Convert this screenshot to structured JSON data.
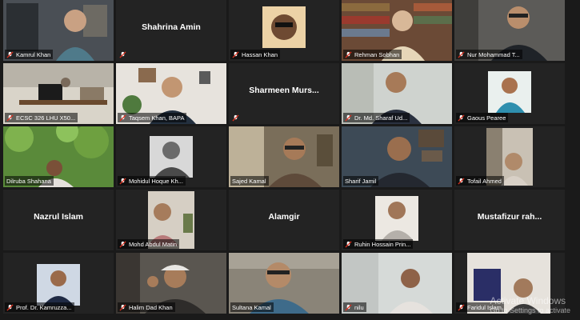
{
  "participants": [
    {
      "label": "Kamrul Khan",
      "center": "",
      "muted": true
    },
    {
      "label": "",
      "center": "Shahrina Amin",
      "muted": true
    },
    {
      "label": "Hassan Khan",
      "center": "",
      "muted": true
    },
    {
      "label": "Rehman Sobhan",
      "center": "",
      "muted": true
    },
    {
      "label": "Nur Mohammad T...",
      "center": "",
      "muted": true
    },
    {
      "label": "ECSC 326 LHU X50...",
      "center": "",
      "muted": true
    },
    {
      "label": "Taqsem Khan, BAPA",
      "center": "",
      "muted": true
    },
    {
      "label": "",
      "center": "Sharmeen  Murs...",
      "muted": true
    },
    {
      "label": "Dr. Md. Sharaf Ud...",
      "center": "",
      "muted": true
    },
    {
      "label": "Gaous Pearee",
      "center": "",
      "muted": true
    },
    {
      "label": "Dilruba Shahana",
      "center": "",
      "muted": false
    },
    {
      "label": "Mohidul Hoque Kh...",
      "center": "",
      "muted": true
    },
    {
      "label": "Sajed Kamal",
      "center": "",
      "muted": false
    },
    {
      "label": "Sharif Jamil",
      "center": "",
      "muted": false
    },
    {
      "label": "Tofail Ahmed",
      "center": "",
      "muted": true
    },
    {
      "label": "",
      "center": "Nazrul Islam",
      "muted": false
    },
    {
      "label": "Mohd Abdul Matin",
      "center": "",
      "muted": true
    },
    {
      "label": "",
      "center": "Alamgir",
      "muted": false
    },
    {
      "label": "Ruhin Hossain Prin...",
      "center": "",
      "muted": true
    },
    {
      "label": "",
      "center": "Mustafizur  rah...",
      "muted": false
    },
    {
      "label": "Prof. Dr. Kamruzza...",
      "center": "",
      "muted": true
    },
    {
      "label": "Halim Dad Khan",
      "center": "",
      "muted": true
    },
    {
      "label": "Sultana Kamal",
      "center": "",
      "muted": false
    },
    {
      "label": "nilu",
      "center": "",
      "muted": true
    },
    {
      "label": "Faridul Islam",
      "center": "",
      "muted": true
    }
  ],
  "active_speaker": "Sharif Jamil",
  "watermark": {
    "line1": "Activate Windows",
    "line2": "Go to Settings to activate"
  },
  "colors": {
    "background": "#1a1a1a",
    "tile": "#232323",
    "active_border": "#c8d23a",
    "muted": "#e0301e"
  }
}
